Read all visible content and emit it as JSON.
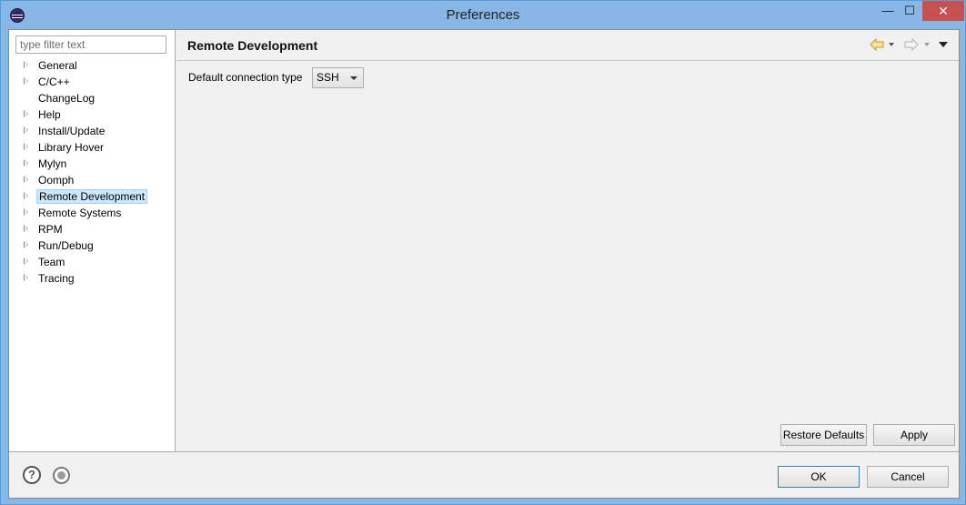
{
  "window": {
    "title": "Preferences",
    "minimize": "—",
    "maximize": "☐",
    "close": "✕"
  },
  "sidebar": {
    "filter_placeholder": "type filter text",
    "items": [
      {
        "label": "General",
        "expandable": true
      },
      {
        "label": "C/C++",
        "expandable": true
      },
      {
        "label": "ChangeLog",
        "expandable": false
      },
      {
        "label": "Help",
        "expandable": true
      },
      {
        "label": "Install/Update",
        "expandable": true
      },
      {
        "label": "Library Hover",
        "expandable": true
      },
      {
        "label": "Mylyn",
        "expandable": true
      },
      {
        "label": "Oomph",
        "expandable": true
      },
      {
        "label": "Remote Development",
        "expandable": true,
        "selected": true
      },
      {
        "label": "Remote Systems",
        "expandable": true
      },
      {
        "label": "RPM",
        "expandable": true
      },
      {
        "label": "Run/Debug",
        "expandable": true
      },
      {
        "label": "Team",
        "expandable": true
      },
      {
        "label": "Tracing",
        "expandable": true
      }
    ]
  },
  "page": {
    "title": "Remote Development",
    "connection_label": "Default connection type",
    "connection_value": "SSH",
    "restore_defaults_label": "Restore Defaults",
    "apply_label": "Apply"
  },
  "footer": {
    "ok_label": "OK",
    "cancel_label": "Cancel",
    "help_symbol": "?"
  },
  "icons": {
    "back": "back-arrow-icon",
    "forward": "forward-arrow-icon",
    "view_menu": "view-menu-icon",
    "help": "help-icon",
    "record": "record-macro-icon"
  },
  "colors": {
    "titlebar": "#86b7e6",
    "selection": "#cce8ff",
    "close_button": "#c75050",
    "back_arrow": "#e8b84a"
  }
}
